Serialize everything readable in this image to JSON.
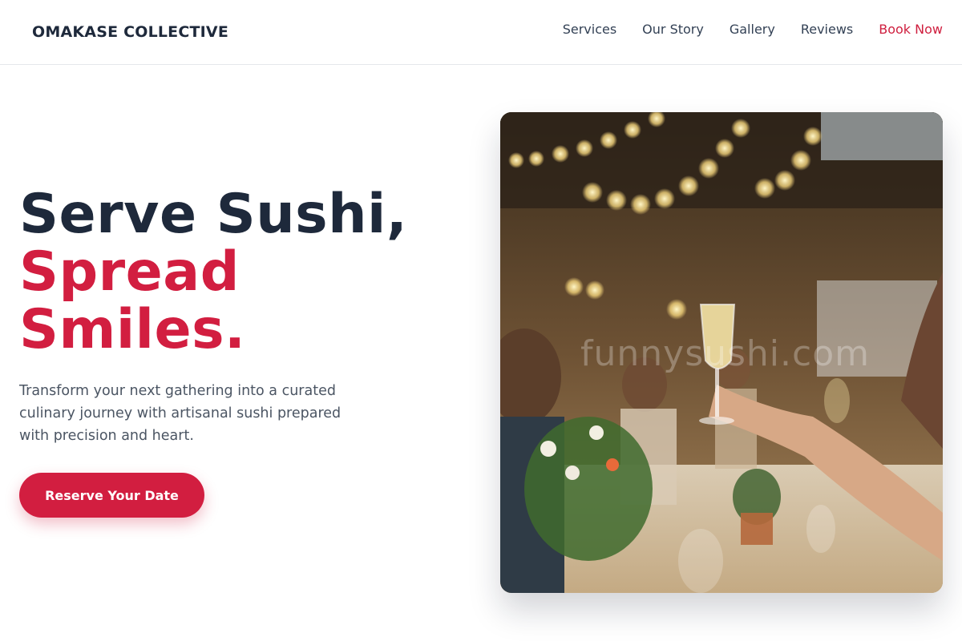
{
  "brand": {
    "name": "OMAKASE COLLECTIVE"
  },
  "nav": {
    "items": [
      {
        "label": "Services"
      },
      {
        "label": "Our Story"
      },
      {
        "label": "Gallery"
      },
      {
        "label": "Reviews"
      },
      {
        "label": "Book Now"
      }
    ]
  },
  "hero": {
    "headline_line1": "Serve Sushi,",
    "headline_line2": "Spread",
    "headline_line3": "Smiles.",
    "subtitle": "Transform your next gathering into a curated culinary journey with artisanal sushi prepared with precision and heart.",
    "cta_label": "Reserve Your Date",
    "image": {
      "watermark": "funnysushi.com"
    }
  },
  "colors": {
    "accent": "#d21e40",
    "heading": "#1e293b",
    "body_text": "#4b5563"
  }
}
